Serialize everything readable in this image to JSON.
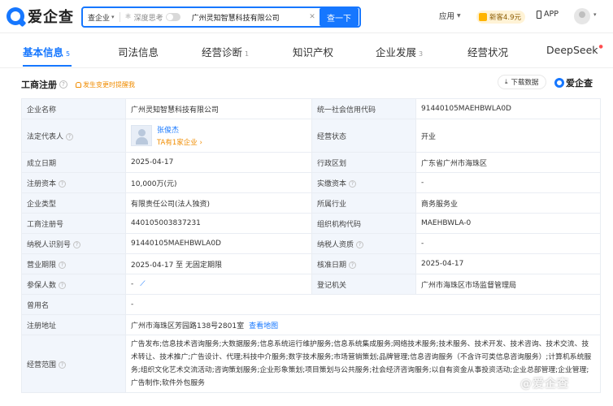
{
  "header": {
    "logo_text": "爱企查",
    "search": {
      "scope": "查企业",
      "deep_think": "深度思考",
      "value": "广州灵知智慧科技有限公司",
      "button": "查一下"
    },
    "apply": "应用",
    "promo": "新客4.9元",
    "app": "APP"
  },
  "tabs": [
    {
      "label": "基本信息",
      "count": "5"
    },
    {
      "label": "司法信息",
      "count": ""
    },
    {
      "label": "经营诊断",
      "count": "1"
    },
    {
      "label": "知识产权",
      "count": ""
    },
    {
      "label": "企业发展",
      "count": "3"
    },
    {
      "label": "经营状况",
      "count": ""
    },
    {
      "label": "DeepSeek",
      "count": ""
    }
  ],
  "section": {
    "title": "工商注册",
    "alert": "发生变更时提醒我",
    "download": "下载数据",
    "brand": "爱企查"
  },
  "rows": {
    "company_name_label": "企业名称",
    "company_name": "广州灵知智慧科技有限公司",
    "credit_code_label": "统一社会信用代码",
    "credit_code": "91440105MAEHBWLA0D",
    "legal_rep_label": "法定代表人",
    "legal_rep_name": "张俊杰",
    "legal_rep_sub": "TA有1家企业",
    "status_label": "经营状态",
    "status": "开业",
    "founded_label": "成立日期",
    "founded": "2025-04-17",
    "region_label": "行政区划",
    "region": "广东省广州市海珠区",
    "capital_label": "注册资本",
    "capital": "10,000万(元)",
    "paid_capital_label": "实缴资本",
    "paid_capital": "-",
    "type_label": "企业类型",
    "type": "有限责任公司(法人独资)",
    "industry_label": "所属行业",
    "industry": "商务服务业",
    "reg_no_label": "工商注册号",
    "reg_no": "440105003837231",
    "org_code_label": "组织机构代码",
    "org_code": "MAEHBWLA-0",
    "taxpayer_id_label": "纳税人识别号",
    "taxpayer_id": "91440105MAEHBWLA0D",
    "taxpayer_qual_label": "纳税人资质",
    "taxpayer_qual": "-",
    "term_label": "营业期限",
    "term": "2025-04-17 至 无固定期限",
    "approval_label": "核准日期",
    "approval": "2025-04-17",
    "insured_label": "参保人数",
    "insured": "-",
    "authority_label": "登记机关",
    "authority": "广州市海珠区市场监督管理局",
    "former_name_label": "曾用名",
    "former_name": "-",
    "address_label": "注册地址",
    "address": "广州市海珠区芳园路138号2801室",
    "map_link": "查看地图",
    "scope_label": "经营范围",
    "scope": "广告发布;信息技术咨询服务;大数据服务;信息系统运行维护服务;信息系统集成服务;网络技术服务;技术服务、技术开发、技术咨询、技术交流、技术转让、技术推广;广告设计、代理;科技中介服务;数字技术服务;市场营销策划;品牌管理;信息咨询服务（不含许可类信息咨询服务）;计算机系统服务;组织文化艺术交流活动;咨询策划服务;企业形象策划;项目策划与公共服务;社会经济咨询服务;以自有资金从事投资活动;企业总部管理;企业管理;广告制作;软件外包服务"
  },
  "watermark": "@爱企查",
  "colors": {
    "accent": "#1677ff",
    "label_bg": "#f2f6fc",
    "warn": "#f08c00"
  }
}
